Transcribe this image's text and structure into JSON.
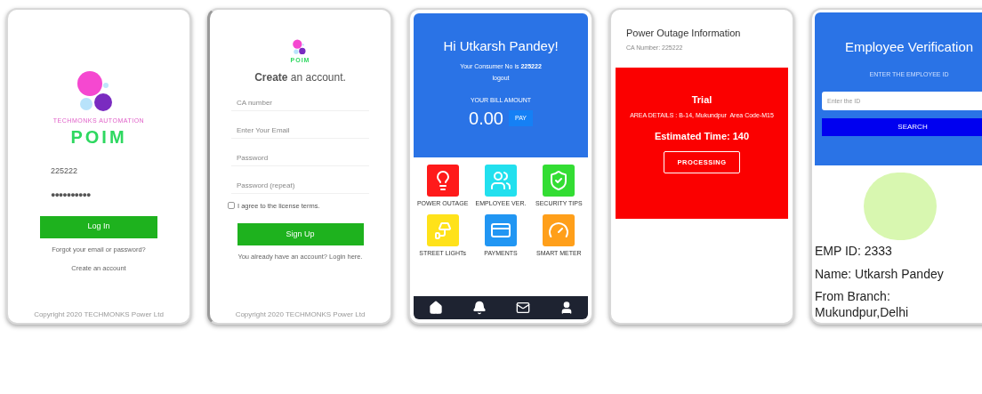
{
  "login": {
    "logo_tagline": "TECHMONKS AUTOMATION",
    "logo_text": "POIM",
    "ca_value": "225222",
    "password_value": "●●●●●●●●●●",
    "login_button": "Log In",
    "forgot_link": "Forgot your email or password?",
    "create_link": "Create an account",
    "copyright": "Copyright 2020 TECHMONKS Power Ltd"
  },
  "signup": {
    "logo_text": "POIM",
    "heading": "**Create** an account.",
    "fields": [
      {
        "placeholder": "CA number"
      },
      {
        "placeholder": "Enter Your Email"
      },
      {
        "placeholder": "Password"
      },
      {
        "placeholder": "Password (repeat)"
      }
    ],
    "agree": {
      "label": "I agree to the license terms.",
      "checked": false
    },
    "signup_button": "Sign Up",
    "login_link": "You already have an account? Login here.",
    "copyright": "Copyright 2020 TECHMONKS Power Ltd"
  },
  "home": {
    "greeting": "Hi Utkarsh Pandey!",
    "consumer": "Your Consumer No is **225222**",
    "logout": "logout",
    "bill_label": "YOUR BILL AMOUNT",
    "bill_amount": "0.00",
    "pay_button": "PAY",
    "tiles": [
      {
        "kind": "outage",
        "label": "POWER OUTAGE",
        "color": "#ff1a1a"
      },
      {
        "kind": "employee",
        "label": "EMPLOYEE VER.",
        "color": "#22e0ee"
      },
      {
        "kind": "security",
        "label": "SECURITY TIPS",
        "color": "#33dd33"
      },
      {
        "kind": "streetlight",
        "label": "STREET LIGHTs",
        "color": "#ffe21a"
      },
      {
        "kind": "payments",
        "label": "PAYMENTS",
        "color": "#2196f3"
      },
      {
        "kind": "meter",
        "label": "SMART METER",
        "color": "#ff9f1a"
      }
    ],
    "nav": [
      {
        "kind": "home"
      },
      {
        "kind": "bell"
      },
      {
        "kind": "mail"
      },
      {
        "kind": "person"
      }
    ]
  },
  "outage": {
    "title": "Power Outage Information",
    "ca": "CA Number: 225222",
    "card_title": "Trial",
    "area": "AREA DETAILS : B-14, Mukundpur  Area Code-M15",
    "estimate": "Estimated Time: 140",
    "status_button": "PROCESSING"
  },
  "employee": {
    "title": "Employee Verification",
    "prompt": "ENTER THE EMPLOYEE ID",
    "id_placeholder": "Enter the ID",
    "search_button": "SEARCH",
    "emp_id": "EMP ID: 2333",
    "name": "Name: Utkarsh Pandey",
    "branch": "From Branch: Mukundpur,Delhi"
  }
}
